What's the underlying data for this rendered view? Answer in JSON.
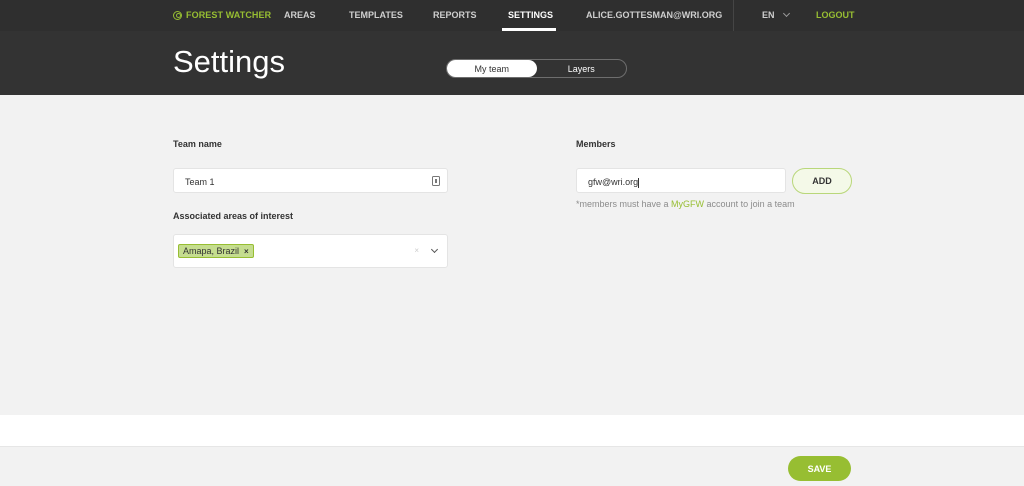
{
  "nav": {
    "brand": "FOREST WATCHER",
    "links": [
      "AREAS",
      "TEMPLATES",
      "REPORTS",
      "SETTINGS"
    ],
    "active": "SETTINGS",
    "user_email": "ALICE.GOTTESMAN@WRI.ORG",
    "language": "EN",
    "logout": "LOGOUT"
  },
  "header": {
    "title": "Settings",
    "tabs": [
      "My team",
      "Layers"
    ],
    "active_tab": "My team"
  },
  "team": {
    "name_label": "Team name",
    "name_value": "Team 1",
    "areas_label": "Associated areas of interest",
    "areas_selected": [
      "Amapa, Brazil"
    ],
    "clear_symbol": "×",
    "chip_remove_symbol": "×"
  },
  "members": {
    "label": "Members",
    "input_value": "gfw@wri.org",
    "add_label": "ADD",
    "note_prefix": "*members must have a ",
    "note_link": "MyGFW",
    "note_suffix": " account to join a team"
  },
  "footer": {
    "save_label": "SAVE"
  },
  "colors": {
    "accent": "#97be32",
    "nav_bg": "#2f2f2f",
    "header_bg": "#333333",
    "content_bg": "#f2f2f2"
  }
}
